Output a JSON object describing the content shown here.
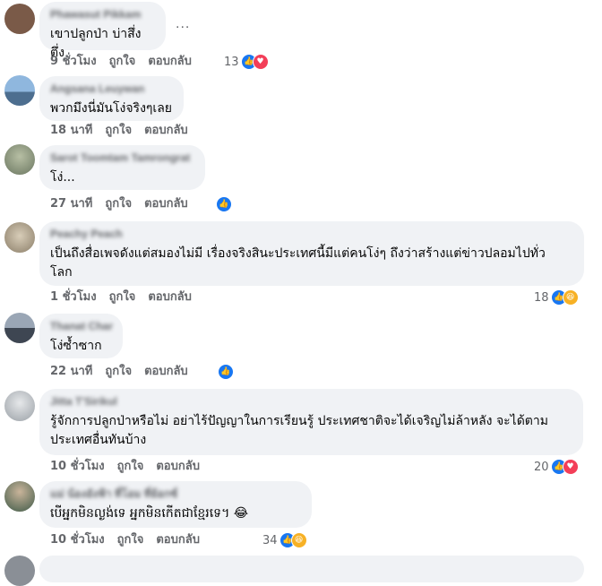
{
  "comments": [
    {
      "author": "Phawasut Pikkam",
      "text": "เขาปลูกป่า บ่าสึ่งตึ่ง",
      "time": "9 ชั่วโมง",
      "like": "ถูกใจ",
      "reply": "ตอบกลับ",
      "reaction_count": "13",
      "reactions": [
        "like",
        "love"
      ],
      "avatar_color": "#7a5a48"
    },
    {
      "author": "Angsana Leuywan",
      "text": "พวกมึงนี่มันโง่จริงๆเลย",
      "time": "18 นาที",
      "like": "ถูกใจ",
      "reply": "ตอบกลับ",
      "reaction_count": "",
      "reactions": [],
      "avatar_color": "#6f9ac7"
    },
    {
      "author": "Sarot Toomtam Tamrongrat",
      "text": "โง่...",
      "time": "27 นาที",
      "like": "ถูกใจ",
      "reply": "ตอบกลับ",
      "reaction_count": "",
      "reactions": [
        "like"
      ],
      "avatar_color": "#8d9a78"
    },
    {
      "author": "Peachy Peach",
      "text_line1": "เป็นถึงสื่อเพจดังแต่สมองไม่มี เรื่องจริงสินะประเทศนี้มีแต่คนโง่ๆ ถึงว่าสร้างแต่ข่าวปลอมไปทั่ว",
      "text_line2": "โลก",
      "time": "1 ชั่วโมง",
      "like": "ถูกใจ",
      "reply": "ตอบกลับ",
      "reaction_count": "18",
      "reactions": [
        "like",
        "haha"
      ],
      "avatar_color": "#a89d8a"
    },
    {
      "author": "Thanat Char",
      "text": "โง่ซ้ำซาก",
      "time": "22 นาที",
      "like": "ถูกใจ",
      "reply": "ตอบกลับ",
      "reaction_count": "",
      "reactions": [
        "like"
      ],
      "avatar_color": "#5a6270"
    },
    {
      "author": "Jitta T'Sirikul",
      "text_line1": "รู้จักการปลูกป่าหรือไม่ อย่าไร้ปัญญาในการเรียนรู้ ประเทศชาติจะได้เจริญไม่ล้าหลัง จะได้ตาม",
      "text_line2": "ประเทศอื่นทันบ้าง",
      "time": "10 ชั่วโมง",
      "like": "ถูกใจ",
      "reply": "ตอบกลับ",
      "reaction_count": "20",
      "reactions": [
        "like",
        "love"
      ],
      "avatar_color": "#9aa0a6"
    },
    {
      "author": "แม่ น้องอังฟ้า ที่โอม ที่ย้อกซ์",
      "text": "បើអ្នកមិនល្ងង់ទេ អ្នកមិនកើតជាខ្មែរទេ។",
      "emoji": "😂",
      "time": "10 ชั่วโมง",
      "like": "ถูกใจ",
      "reply": "ตอบกลับ",
      "reaction_count": "34",
      "reactions": [
        "like",
        "haha"
      ],
      "avatar_color": "#5f7f6a"
    }
  ],
  "icons": {
    "like": "thumbs-up-icon",
    "love": "heart-icon",
    "haha": "laughing-face-icon",
    "more": "more-options-icon"
  },
  "more_label": "...",
  "colors": {
    "bubble": "#f0f2f5",
    "like": "#1877f2",
    "love": "#f33e58",
    "haha": "#f7b125",
    "meta": "#65676b"
  }
}
